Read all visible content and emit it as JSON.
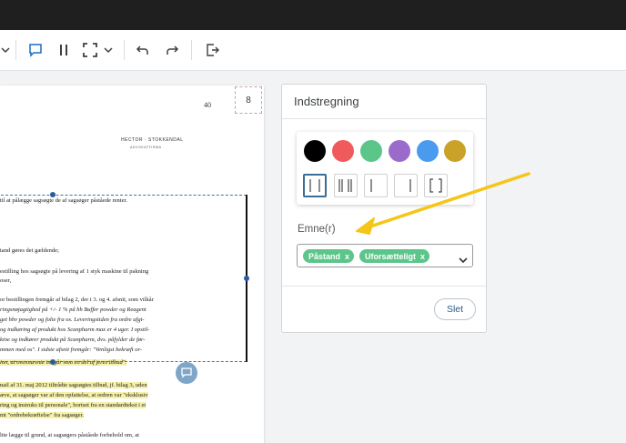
{
  "toolbar": {
    "icons": [
      "chevron-down-icon",
      "comment-icon",
      "split-columns-icon",
      "crop-select-icon",
      "chevron-down-icon",
      "undo-icon",
      "redo-icon",
      "export-icon"
    ]
  },
  "document": {
    "page_number_box": "8",
    "page_number": "40",
    "letterhead": "HECTOR · STOKKENDAL",
    "letterhead_sub": "ADVOKATFIRMA",
    "lines": [
      "til at pålægge sagsøgte de af sagsøger påståede renter.",
      "tand gøres det gældende;",
      "estilling hos sagsøgte på levering af 1 styk maskine til pakning",
      "oser,",
      "or bestillingen fremgår af bilag 2, der i 3. og 4. afsnit, som vilkår",
      "ringsnøjagtighed på +/- 1 % på hh Buffer powder og Reagent",
      "get hhv powder og folie fra os. Leveringstiden fra ordre afgi-",
      "og indkøring af produkt hos Scanpharm max er 4 uger. I opstil-",
      "kine og indkører produkt på Scanpharm, dvs. påfylder de før-",
      "mmen med os\". I sidste afsnit fremgår: \"Venligst bekræft or-",
      "ion, at ovennævnte indgår som en del af jeres tilbud\".",
      "nail af 31. maj 2012 tiltrådte sagsøgtes tilbud, jf. bilag 3, uden",
      "æve, at sagsøger var af den opfattelse, at ordren var \"eksklusiv",
      "ring og instruks til personale\", bortset fra en standardtekst i et",
      "mt \"ordrebekræftelse\" fra sagsøger.",
      "ltte lægge til grund, at sagsøgers påståede forbehold om, at"
    ]
  },
  "panel": {
    "title": "Indstregning",
    "colors": [
      "#000000",
      "#f05a5a",
      "#5cc58a",
      "#9b6bcc",
      "#4a9af0",
      "#c9a227"
    ],
    "line_styles": [
      "single-bar",
      "double-bar",
      "left-bar",
      "right-bar",
      "brackets"
    ],
    "topic_label": "Emne(r)",
    "tags": [
      "Påstand",
      "Uforsætteligt"
    ],
    "tag_remove": "x",
    "delete_button": "Slet"
  },
  "annotation_arrow_color": "#f5c518"
}
